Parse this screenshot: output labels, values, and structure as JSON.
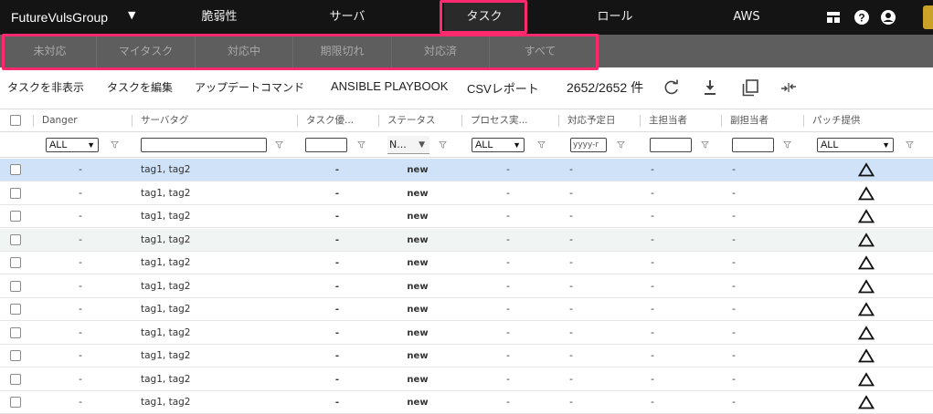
{
  "nav": {
    "brand": "FutureVulsGroup",
    "items": [
      {
        "label": "脆弱性"
      },
      {
        "label": "サーバ"
      },
      {
        "label": "タスク"
      },
      {
        "label": "ロール"
      },
      {
        "label": "AWS"
      }
    ],
    "active_item": "タスク",
    "tools": [
      "layout-icon",
      "help-icon",
      "account-icon"
    ],
    "highlight_color": "#ff2a6d"
  },
  "subtabs": [
    "未対応",
    "マイタスク",
    "対応中",
    "期限切れ",
    "対応済",
    "すべて"
  ],
  "toolbar": {
    "hide_tasks": "タスクを非表示",
    "edit_tasks": "タスクを編集",
    "update_command": "アップデートコマンド",
    "ansible": "ANSIBLE PLAYBOOK",
    "csv": "CSVレポート",
    "count": "2652/2652 件",
    "icons": [
      "refresh-icon",
      "download-icon",
      "copy-icon",
      "compress-icon"
    ]
  },
  "columns": {
    "danger": "Danger",
    "server_tag": "サーバタグ",
    "task_priority": "タスク優...",
    "status": "ステータス",
    "process": "プロセス実...",
    "due_date": "対応予定日",
    "owner": "主担当者",
    "sub_owner": "副担当者",
    "patch": "パッチ提供"
  },
  "filters": {
    "danger": "ALL",
    "status": "N...",
    "process": "ALL",
    "due_date_placeholder": "yyyy-r",
    "patch": "ALL"
  },
  "rows": [
    {
      "danger": "-",
      "tags": "tag1, tag2",
      "priority": "-",
      "status": "new",
      "process": "-",
      "due": "-",
      "owner": "-",
      "sub": "-",
      "patch": "triangle"
    },
    {
      "danger": "-",
      "tags": "tag1, tag2",
      "priority": "-",
      "status": "new",
      "process": "-",
      "due": "-",
      "owner": "-",
      "sub": "-",
      "patch": "triangle"
    },
    {
      "danger": "-",
      "tags": "tag1, tag2",
      "priority": "-",
      "status": "new",
      "process": "-",
      "due": "-",
      "owner": "-",
      "sub": "-",
      "patch": "triangle"
    },
    {
      "danger": "-",
      "tags": "tag1, tag2",
      "priority": "-",
      "status": "new",
      "process": "-",
      "due": "-",
      "owner": "-",
      "sub": "-",
      "patch": "triangle"
    },
    {
      "danger": "-",
      "tags": "tag1, tag2",
      "priority": "-",
      "status": "new",
      "process": "-",
      "due": "-",
      "owner": "-",
      "sub": "-",
      "patch": "triangle"
    },
    {
      "danger": "-",
      "tags": "tag1, tag2",
      "priority": "-",
      "status": "new",
      "process": "-",
      "due": "-",
      "owner": "-",
      "sub": "-",
      "patch": "triangle"
    },
    {
      "danger": "-",
      "tags": "tag1, tag2",
      "priority": "-",
      "status": "new",
      "process": "-",
      "due": "-",
      "owner": "-",
      "sub": "-",
      "patch": "triangle"
    },
    {
      "danger": "-",
      "tags": "tag1, tag2",
      "priority": "-",
      "status": "new",
      "process": "-",
      "due": "-",
      "owner": "-",
      "sub": "-",
      "patch": "triangle"
    },
    {
      "danger": "-",
      "tags": "tag1, tag2",
      "priority": "-",
      "status": "new",
      "process": "-",
      "due": "-",
      "owner": "-",
      "sub": "-",
      "patch": "triangle"
    },
    {
      "danger": "-",
      "tags": "tag1, tag2",
      "priority": "-",
      "status": "new",
      "process": "-",
      "due": "-",
      "owner": "-",
      "sub": "-",
      "patch": "triangle"
    },
    {
      "danger": "-",
      "tags": "tag1, tag2",
      "priority": "-",
      "status": "new",
      "process": "-",
      "due": "-",
      "owner": "-",
      "sub": "-",
      "patch": "triangle"
    }
  ],
  "selected_row": 1,
  "striped_row": 4,
  "colors": {
    "selected_row": "#cfe2f8",
    "nav_bg": "#141414",
    "subtab_bg": "#5e5e5e"
  }
}
